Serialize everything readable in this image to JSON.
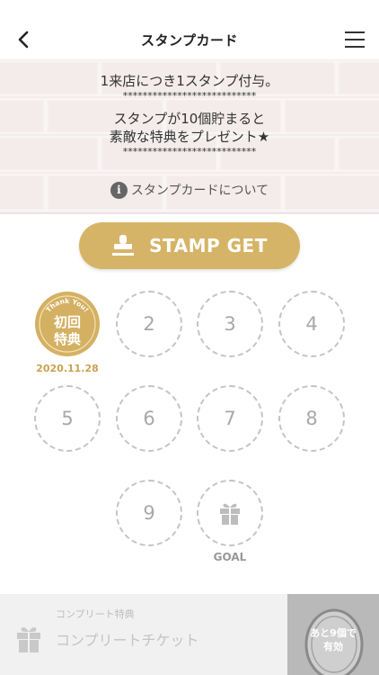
{
  "nav": {
    "title": "スタンプカード"
  },
  "banner": {
    "line1": "1来店につき1スタンプ付与。",
    "stars": "***************************",
    "line2": "スタンプが10個貯まると",
    "line3": "素敵な特典をプレゼント★",
    "about_icon": "i",
    "about_text": "スタンプカードについて"
  },
  "stamp_button": {
    "label": "STAMP GET",
    "icon": "stamp-icon"
  },
  "stamps": {
    "first": {
      "arc_text": "Thank You!",
      "line1": "初回",
      "line2": "特典",
      "date": "2020.11.28"
    },
    "slots": [
      "2",
      "3",
      "4",
      "5",
      "6",
      "7",
      "8",
      "9"
    ],
    "goal_label": "GOAL"
  },
  "complete": {
    "title": "コンプリート特典",
    "ticket": "コンプリートチケット",
    "remaining_line1": "あと9個で",
    "remaining_line2": "有効"
  },
  "colors": {
    "gold": "#d6b467",
    "gold_dark": "#c9a24f",
    "dashed": "#c4c4c4"
  }
}
